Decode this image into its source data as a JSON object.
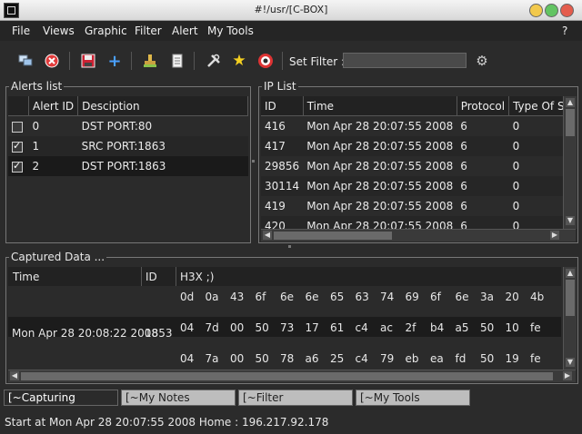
{
  "window": {
    "title": "#!/usr/[C-BOX]"
  },
  "menu": {
    "file": "File",
    "views": "Views",
    "graphic": "Graphic",
    "filter": "Filter",
    "alert": "Alert",
    "my_tools": "My Tools",
    "help": "?"
  },
  "toolbar": {
    "set_filter_label": "Set Filter :",
    "set_filter_value": ""
  },
  "alerts": {
    "title": "Alerts list",
    "columns": [
      "Alert ID",
      "Desciption"
    ],
    "rows": [
      {
        "id": "0",
        "desc": "DST PORT:80",
        "checked": false
      },
      {
        "id": "1",
        "desc": "SRC PORT:1863",
        "checked": true
      },
      {
        "id": "2",
        "desc": "DST PORT:1863",
        "checked": true
      }
    ]
  },
  "ip": {
    "title": "IP List",
    "columns": [
      "ID",
      "Time",
      "Protocol",
      "Type Of Service"
    ],
    "rows": [
      [
        "416",
        "Mon Apr 28 20:07:55 2008",
        "6",
        "0"
      ],
      [
        "417",
        "Mon Apr 28 20:07:55 2008",
        "6",
        "0"
      ],
      [
        "29856",
        "Mon Apr 28 20:07:55 2008",
        "6",
        "0"
      ],
      [
        "30114",
        "Mon Apr 28 20:07:55 2008",
        "6",
        "0"
      ],
      [
        "419",
        "Mon Apr 28 20:07:55 2008",
        "6",
        "0"
      ],
      [
        "420",
        "Mon Apr 28 20:07:55 2008",
        "6",
        "0"
      ]
    ]
  },
  "captured": {
    "title": "Captured Data ...",
    "columns": [
      "Time",
      "ID",
      "H3X ;)"
    ],
    "time": "Mon Apr 28 20:08:22 2008",
    "id": "1853",
    "hex_rows": [
      [
        "0d",
        "0a",
        "43",
        "6f",
        "6e",
        "6e",
        "65",
        "63",
        "74",
        "69",
        "6f",
        "6e",
        "3a",
        "20",
        "4b"
      ],
      [
        "04",
        "7d",
        "00",
        "50",
        "73",
        "17",
        "61",
        "c4",
        "ac",
        "2f",
        "b4",
        "a5",
        "50",
        "10",
        "fe"
      ],
      [
        "04",
        "7a",
        "00",
        "50",
        "78",
        "a6",
        "25",
        "c4",
        "79",
        "eb",
        "ea",
        "fd",
        "50",
        "19",
        "fe"
      ]
    ]
  },
  "tabs": [
    "[~Capturing",
    "[~My Notes",
    "[~Filter",
    "[~My Tools"
  ],
  "status": "Start at Mon Apr 28 20:07:55 2008 Home : 196.217.92.178"
}
